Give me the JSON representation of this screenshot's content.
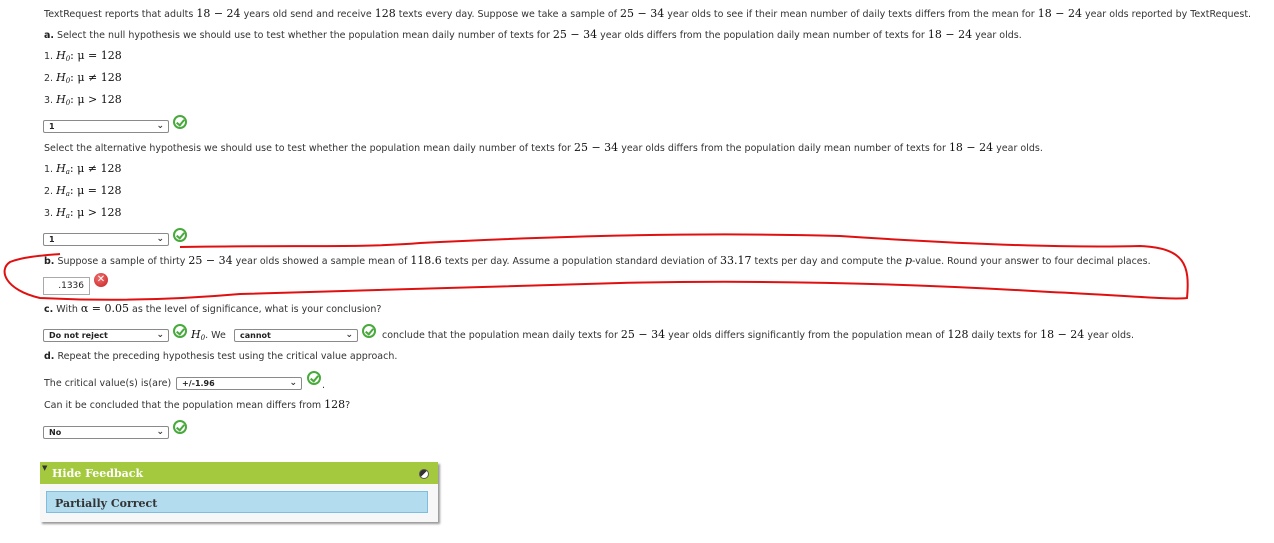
{
  "intro": {
    "text_1": "TextRequest reports that adults ",
    "range_a": "18 − 24",
    "text_2": " years old send and receive ",
    "mean_value": "128",
    "text_3": " texts every day. Suppose we take a sample of ",
    "range_b": "25 − 34",
    "text_4": " year olds to see if their mean number of daily texts differs from the mean for ",
    "range_c": "18 − 24",
    "text_5": " year olds reported by TextRequest."
  },
  "part_a": {
    "label": "a.",
    "text_1": " Select the null hypothesis we should use to test whether the population mean daily number of texts for ",
    "range_b": "25 − 34",
    "text_2": " year olds differs from the population daily mean number of texts for ",
    "range_c": "18 − 24",
    "text_3": " year olds.",
    "null_options": [
      {
        "num": "1.",
        "symbol": "H",
        "sub": "0",
        "relation": ": μ = 128"
      },
      {
        "num": "2.",
        "symbol": "H",
        "sub": "0",
        "relation": ": μ ≠ 128"
      },
      {
        "num": "3.",
        "symbol": "H",
        "sub": "0",
        "relation": ": μ > 128"
      }
    ],
    "null_selected": "1",
    "alt_prompt_1": "Select the alternative hypothesis we should use to test whether the population mean daily number of texts for ",
    "alt_range_b": "25 − 34",
    "alt_prompt_2": " year olds differs from the population daily mean number of texts for ",
    "alt_range_c": "18 − 24",
    "alt_prompt_3": " year olds.",
    "alt_options": [
      {
        "num": "1.",
        "symbol": "H",
        "sub": "a",
        "relation": ": μ ≠ 128"
      },
      {
        "num": "2.",
        "symbol": "H",
        "sub": "a",
        "relation": ": μ = 128"
      },
      {
        "num": "3.",
        "symbol": "H",
        "sub": "a",
        "relation": ": μ > 128"
      }
    ],
    "alt_selected": "1"
  },
  "part_b": {
    "label": "b.",
    "text_1": " Suppose a sample of thirty ",
    "range_b": "25 − 34",
    "text_2": " year olds showed a sample mean of ",
    "sample_mean": "118.6",
    "text_3": " texts per day. Assume a population standard deviation of ",
    "std_dev": "33.17",
    "text_4": " texts per day and compute the ",
    "p": "p",
    "text_5": "-value. Round your answer to four decimal places.",
    "answer_value": ".1336",
    "answer_status": "incorrect"
  },
  "part_c": {
    "label": "c.",
    "text_1": " With ",
    "alpha": "α = 0.05",
    "text_2": " as the level of significance, what is your conclusion?",
    "decision_selected": "Do not reject",
    "h0_symbol": "H",
    "h0_sub": "0",
    "text_we": ". We ",
    "can_selected": "cannot",
    "text_3": " conclude that the population mean daily texts for ",
    "range_b": "25 − 34",
    "text_4": " year olds differs significantly from the population mean of ",
    "mean_value": "128",
    "text_5": " daily texts for ",
    "range_c": "18 − 24",
    "text_6": " year olds."
  },
  "part_d": {
    "label": "d.",
    "text_1": " Repeat the preceding hypothesis test using the critical value approach.",
    "critical_prompt": "The critical value(s) is(are)",
    "critical_selected": "+/-1.96",
    "critical_period": ".",
    "conclude_prompt": "Can it be concluded that the population mean differs from ",
    "conclude_value": "128",
    "conclude_q": "?",
    "conclude_selected": "No"
  },
  "feedback": {
    "toggle_label": "Hide Feedback",
    "status": "Partially Correct",
    "header_color": "#a4c93e",
    "box_color": "#b3dcee"
  },
  "colors": {
    "correct": "#48a93c",
    "incorrect": "#c72020",
    "annotation": "#e01010"
  }
}
